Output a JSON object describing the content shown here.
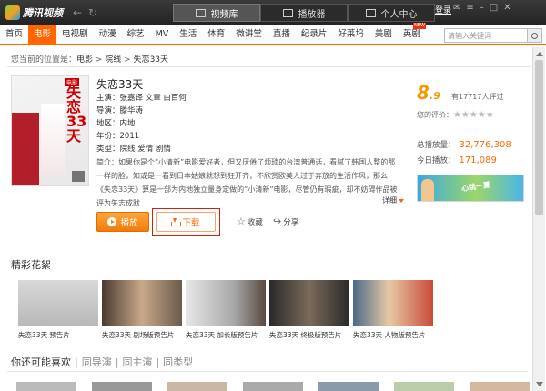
{
  "app": {
    "name": "腾讯视频"
  },
  "top_tabs": [
    {
      "label": "视频库",
      "icon": "film-icon",
      "active": true
    },
    {
      "label": "播放器",
      "icon": "player-icon",
      "active": false
    },
    {
      "label": "个人中心",
      "icon": "user-icon",
      "active": false
    }
  ],
  "login_label": "登录",
  "nav": [
    "首页",
    "电影",
    "电视剧",
    "动漫",
    "综艺",
    "MV",
    "生活",
    "体育",
    "微讲堂",
    "直播",
    "纪录片",
    "好莱坞",
    "美剧",
    "英剧"
  ],
  "nav_active": "电影",
  "search": {
    "placeholder": "请输入关键词"
  },
  "breadcrumb": {
    "prefix": "您当前的位置是：",
    "items": [
      "电影",
      "院线",
      "失恋33天"
    ],
    "sep": " > "
  },
  "poster": {
    "title": "失恋33天",
    "tag": "电影"
  },
  "movie": {
    "title": "失恋33天",
    "rows": [
      {
        "label": "主演：",
        "value": "张嘉译 文章 白百何"
      },
      {
        "label": "导演：",
        "value": "滕华涛"
      },
      {
        "label": "地区：",
        "value": "内地"
      },
      {
        "label": "年份：",
        "value": "2011"
      },
      {
        "label": "类型：",
        "value": "院线  爱情  剧情"
      }
    ],
    "synopsis_label": "简介：",
    "synopsis": "如果你是个“小清新”电影爱好者，但又厌倦了烦琐的台湾普通话，看腻了韩国人整的那一样的脸，知或是一看到日本姑娘就想到狂开齐，不欣赏欧美人过于奔放的生活作风，那么《失恋33天》算是一部为内地独立量身定做的“小清新”电影，尽管仍有瑕疵，却不妨碍作品被评为矢志成默",
    "detail_label": "详细"
  },
  "rating": {
    "score_big": "8",
    "score_small": ".9",
    "count_text": "有17717人评过",
    "my_label": "您的评价：",
    "stars": "★★★★★"
  },
  "stats": {
    "total_label": "总播放量：",
    "total": "32,776,308",
    "today_label": "今日播放：",
    "today": "171,089"
  },
  "ad": {
    "text": "心跳一夏"
  },
  "actions": {
    "play": "播放",
    "download": "下载",
    "favorite": "收藏",
    "share": "分享"
  },
  "highlights": {
    "title": "精彩花絮",
    "items": [
      {
        "caption": "失恋33天  预告片"
      },
      {
        "caption": "失恋33天  剧场版预告片"
      },
      {
        "caption": "失恋33天  加长版预告片"
      },
      {
        "caption": "失恋33天  终极版预告片"
      },
      {
        "caption": "失恋33天  人物版预告片"
      }
    ]
  },
  "related": {
    "title": "你还可能喜欢",
    "tabs": [
      "同导演",
      "同主演",
      "同类型"
    ]
  },
  "colors": {
    "accent": "#ff6600",
    "titlebar": "#2a2a2a",
    "highlight_border": "#d81e06"
  }
}
